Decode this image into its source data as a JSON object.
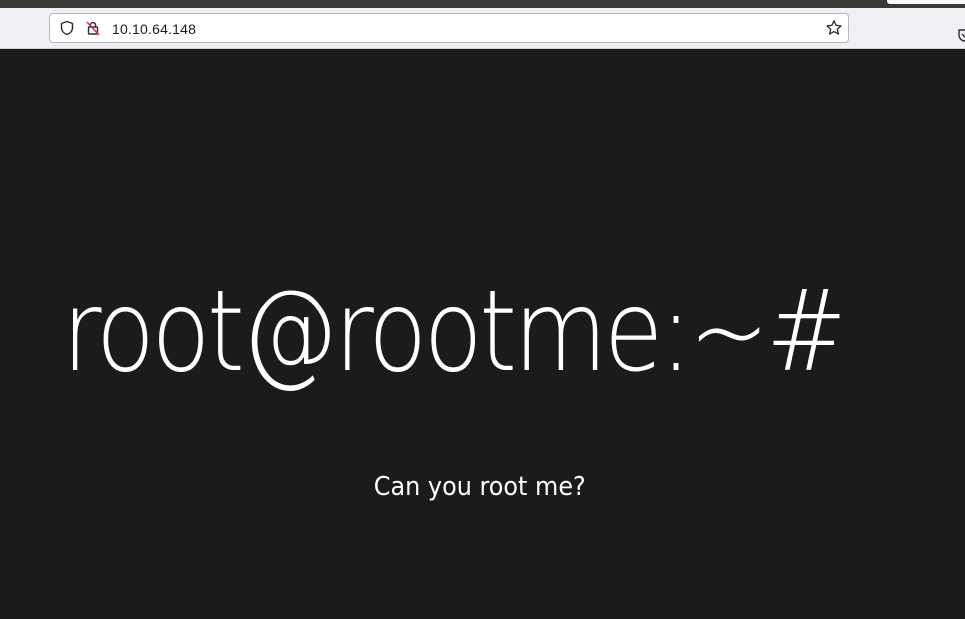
{
  "browser": {
    "url": "10.10.64.148",
    "icons": {
      "tracking_protection": "shield-icon",
      "connection": "insecure-lock-icon",
      "bookmark": "star-icon",
      "pocket": "pocket-icon"
    }
  },
  "page": {
    "heading": "root@rootme:~#",
    "subheading": "Can you root me?",
    "colors": {
      "background": "#1b1b1b",
      "text": "#ffffff"
    }
  }
}
